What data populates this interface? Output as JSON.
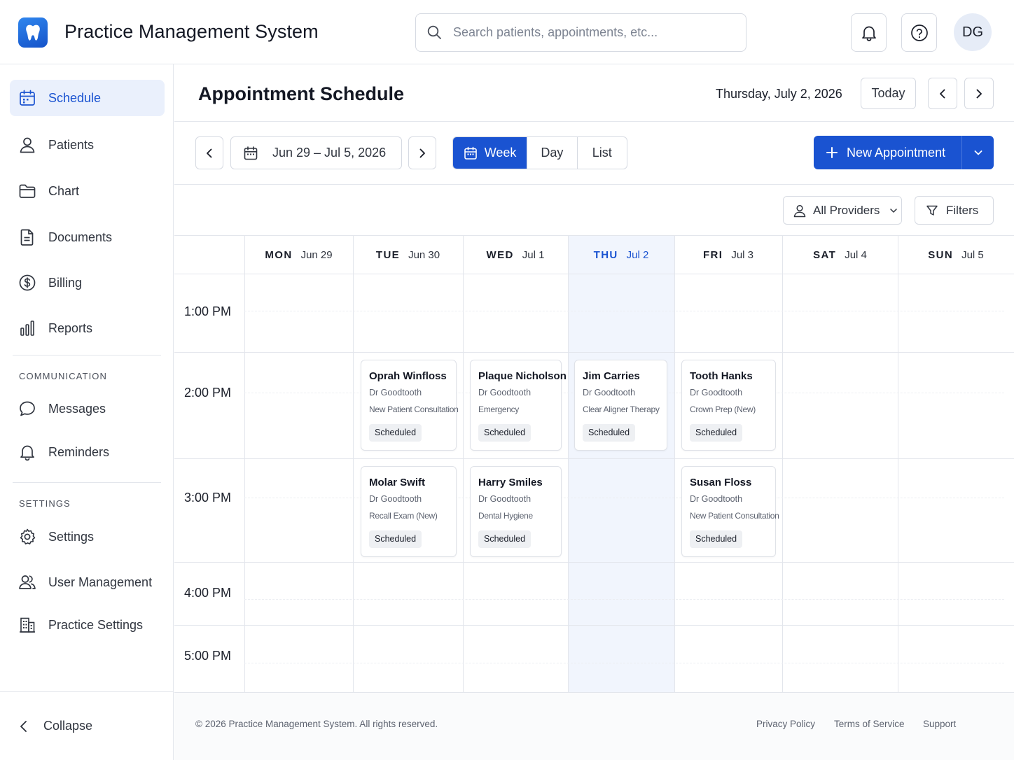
{
  "app": {
    "title": "Practice Management System",
    "search_placeholder": "Search patients, appointments, etc...",
    "user_initials": "DG"
  },
  "colors": {
    "accent": "#1a53d1",
    "today_column": "#f1f5fd",
    "active_nav_bg": "#eaf0fc"
  },
  "sidebar": {
    "items": [
      {
        "label": "Schedule",
        "icon": "calendar-icon",
        "active": true
      },
      {
        "label": "Patients",
        "icon": "user-icon"
      },
      {
        "label": "Chart",
        "icon": "folder-icon"
      },
      {
        "label": "Documents",
        "icon": "document-icon"
      },
      {
        "label": "Billing",
        "icon": "dollar-icon"
      },
      {
        "label": "Reports",
        "icon": "bar-chart-icon"
      }
    ],
    "communication_label": "COMMUNICATION",
    "communication": [
      {
        "label": "Messages",
        "icon": "message-icon"
      },
      {
        "label": "Reminders",
        "icon": "bell-icon"
      }
    ],
    "settings_label": "SETTINGS",
    "settings": [
      {
        "label": "Settings",
        "icon": "gear-icon"
      },
      {
        "label": "User Management",
        "icon": "users-icon"
      },
      {
        "label": "Practice Settings",
        "icon": "building-icon"
      }
    ],
    "collapse_label": "Collapse"
  },
  "header": {
    "page_title": "Appointment Schedule",
    "current_date": "Thursday, July 2, 2026",
    "today_label": "Today"
  },
  "toolbar": {
    "date_range": "Jun 29 – Jul 5, 2026",
    "views": [
      "Week",
      "Day",
      "List"
    ],
    "active_view": "Week",
    "new_appointment_label": "New Appointment",
    "providers_label": "All Providers",
    "filters_label": "Filters"
  },
  "calendar": {
    "days": [
      {
        "dow": "MON",
        "date": "Jun 29"
      },
      {
        "dow": "TUE",
        "date": "Jun 30"
      },
      {
        "dow": "WED",
        "date": "Jul 1"
      },
      {
        "dow": "THU",
        "date": "Jul 2",
        "today": true
      },
      {
        "dow": "FRI",
        "date": "Jul 3"
      },
      {
        "dow": "SAT",
        "date": "Jul 4"
      },
      {
        "dow": "SUN",
        "date": "Jul 5"
      }
    ],
    "times": [
      "1:00 PM",
      "2:00 PM",
      "3:00 PM",
      "4:00 PM",
      "5:00 PM"
    ],
    "appointments": [
      {
        "day": "TUE",
        "time": "2:00 PM",
        "patient": "Oprah Winfloss",
        "provider": "Dr Goodtooth",
        "procedure": "New Patient Consultation",
        "status": "Scheduled"
      },
      {
        "day": "WED",
        "time": "2:00 PM",
        "patient": "Plaque Nicholson",
        "provider": "Dr Goodtooth",
        "procedure": "Emergency",
        "status": "Scheduled"
      },
      {
        "day": "THU",
        "time": "2:00 PM",
        "patient": "Jim Carries",
        "provider": "Dr Goodtooth",
        "procedure": "Clear Aligner Therapy",
        "status": "Scheduled"
      },
      {
        "day": "FRI",
        "time": "2:00 PM",
        "patient": "Tooth Hanks",
        "provider": "Dr Goodtooth",
        "procedure": "Crown Prep (New)",
        "status": "Scheduled"
      },
      {
        "day": "TUE",
        "time": "3:00 PM",
        "patient": "Molar Swift",
        "provider": "Dr Goodtooth",
        "procedure": "Recall Exam (New)",
        "status": "Scheduled"
      },
      {
        "day": "WED",
        "time": "3:00 PM",
        "patient": "Harry Smiles",
        "provider": "Dr Goodtooth",
        "procedure": "Dental Hygiene",
        "status": "Scheduled"
      },
      {
        "day": "FRI",
        "time": "3:00 PM",
        "patient": "Susan Floss",
        "provider": "Dr Goodtooth",
        "procedure": "New Patient Consultation",
        "status": "Scheduled"
      }
    ]
  },
  "footer": {
    "copyright": "© 2026 Practice Management System. All rights reserved.",
    "links": [
      "Privacy Policy",
      "Terms of Service",
      "Support"
    ]
  }
}
